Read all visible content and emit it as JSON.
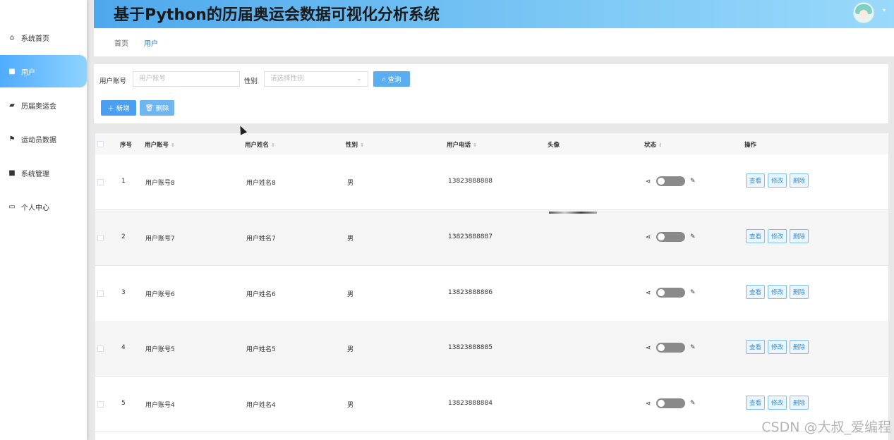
{
  "header": {
    "title": "基于Python的历届奥运会数据可视化分析系统",
    "avatar_icon": "avatar-icon",
    "caret": "▾"
  },
  "sidebar": {
    "items": [
      {
        "label": "系统首页",
        "icon": "home-icon",
        "glyph": "⌂"
      },
      {
        "label": "用户",
        "icon": "grid-icon",
        "glyph": "■"
      },
      {
        "label": "历届奥运会",
        "icon": "wallet-icon",
        "glyph": "▰"
      },
      {
        "label": "运动员数据",
        "icon": "flag-icon",
        "glyph": "⚑"
      },
      {
        "label": "系统管理",
        "icon": "grid-icon",
        "glyph": "■"
      },
      {
        "label": "个人中心",
        "icon": "card-icon",
        "glyph": "▭"
      }
    ]
  },
  "breadcrumb": {
    "home": "首页",
    "current": "用户"
  },
  "search": {
    "account_label": "用户账号",
    "account_placeholder": "用户账号",
    "gender_label": "性别",
    "gender_placeholder": "请选择性别",
    "query_label": "查询",
    "add_label": "新增",
    "delete_label": "删除"
  },
  "table": {
    "headers": {
      "index": "序号",
      "account": "用户账号",
      "name": "用户姓名",
      "gender": "性别",
      "phone": "用户电话",
      "avatar": "头像",
      "status": "状态",
      "ops": "操作"
    },
    "op_labels": {
      "view": "查看",
      "edit": "修改",
      "delete": "删除"
    },
    "rows": [
      {
        "index": "1",
        "account": "用户账号8",
        "name": "用户姓名8",
        "gender": "男",
        "phone": "13823888888",
        "status_on": false
      },
      {
        "index": "2",
        "account": "用户账号7",
        "name": "用户姓名7",
        "gender": "男",
        "phone": "13823888887",
        "status_on": false
      },
      {
        "index": "3",
        "account": "用户账号6",
        "name": "用户姓名6",
        "gender": "男",
        "phone": "13823888886",
        "status_on": false
      },
      {
        "index": "4",
        "account": "用户账号5",
        "name": "用户姓名5",
        "gender": "男",
        "phone": "13823888885",
        "status_on": false
      },
      {
        "index": "5",
        "account": "用户账号4",
        "name": "用户姓名4",
        "gender": "男",
        "phone": "13823888884",
        "status_on": false
      }
    ]
  },
  "watermark": "CSDN @大叔_爱编程",
  "colors": {
    "accent": "#4facfe",
    "header_start": "#4ea8ec",
    "header_end": "#99d9fb",
    "button_blue": "#5aaef0"
  }
}
